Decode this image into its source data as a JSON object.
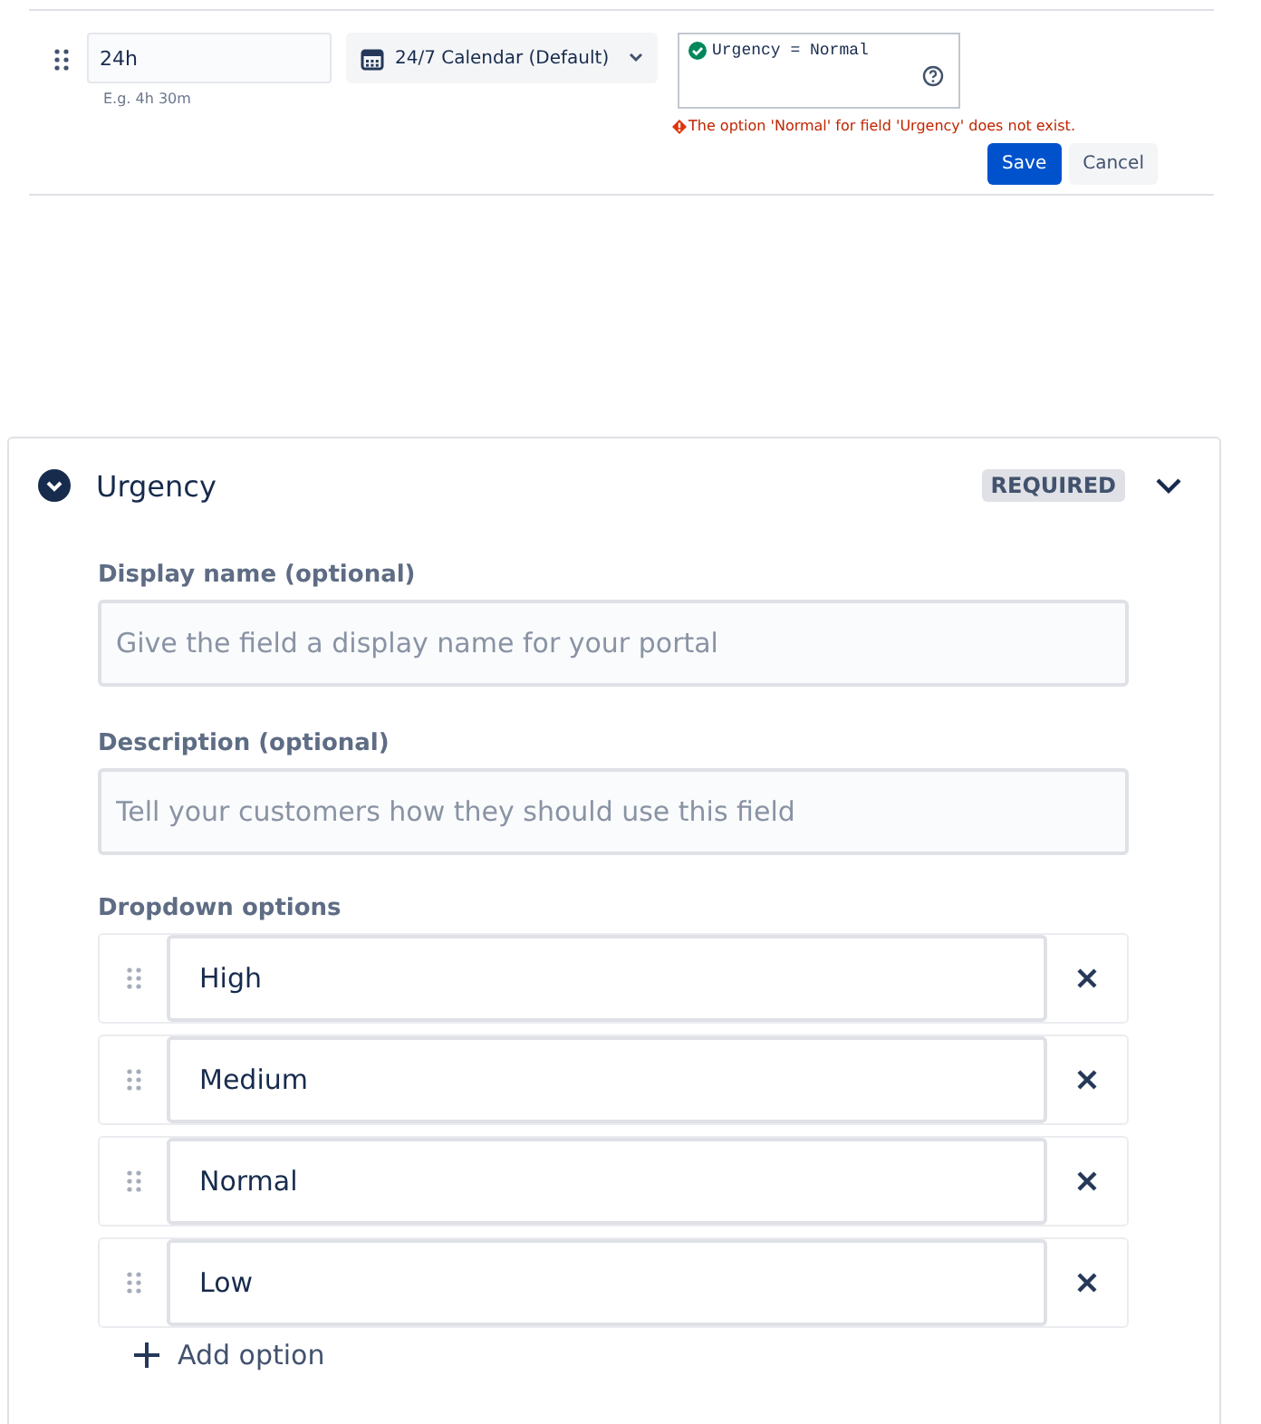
{
  "sla_row": {
    "duration": "24h",
    "duration_hint": "E.g. 4h 30m",
    "calendar": "24/7 Calendar (Default)",
    "condition": "Urgency = Normal",
    "condition_valid": true,
    "error": "The option 'Normal' for field 'Urgency' does not exist.",
    "save": "Save",
    "cancel": "Cancel"
  },
  "field_card": {
    "title": "Urgency",
    "expanded": true,
    "badge": "REQUIRED",
    "display_name": {
      "label": "Display name (optional)",
      "placeholder": "Give the field a display name for your portal"
    },
    "description": {
      "label": "Description (optional)",
      "placeholder": "Tell your customers how they should use this field"
    },
    "options_label": "Dropdown options",
    "options": [
      {
        "value": "High"
      },
      {
        "value": "Medium"
      },
      {
        "value": "Normal"
      },
      {
        "value": "Low"
      }
    ],
    "add_option": "Add option"
  }
}
